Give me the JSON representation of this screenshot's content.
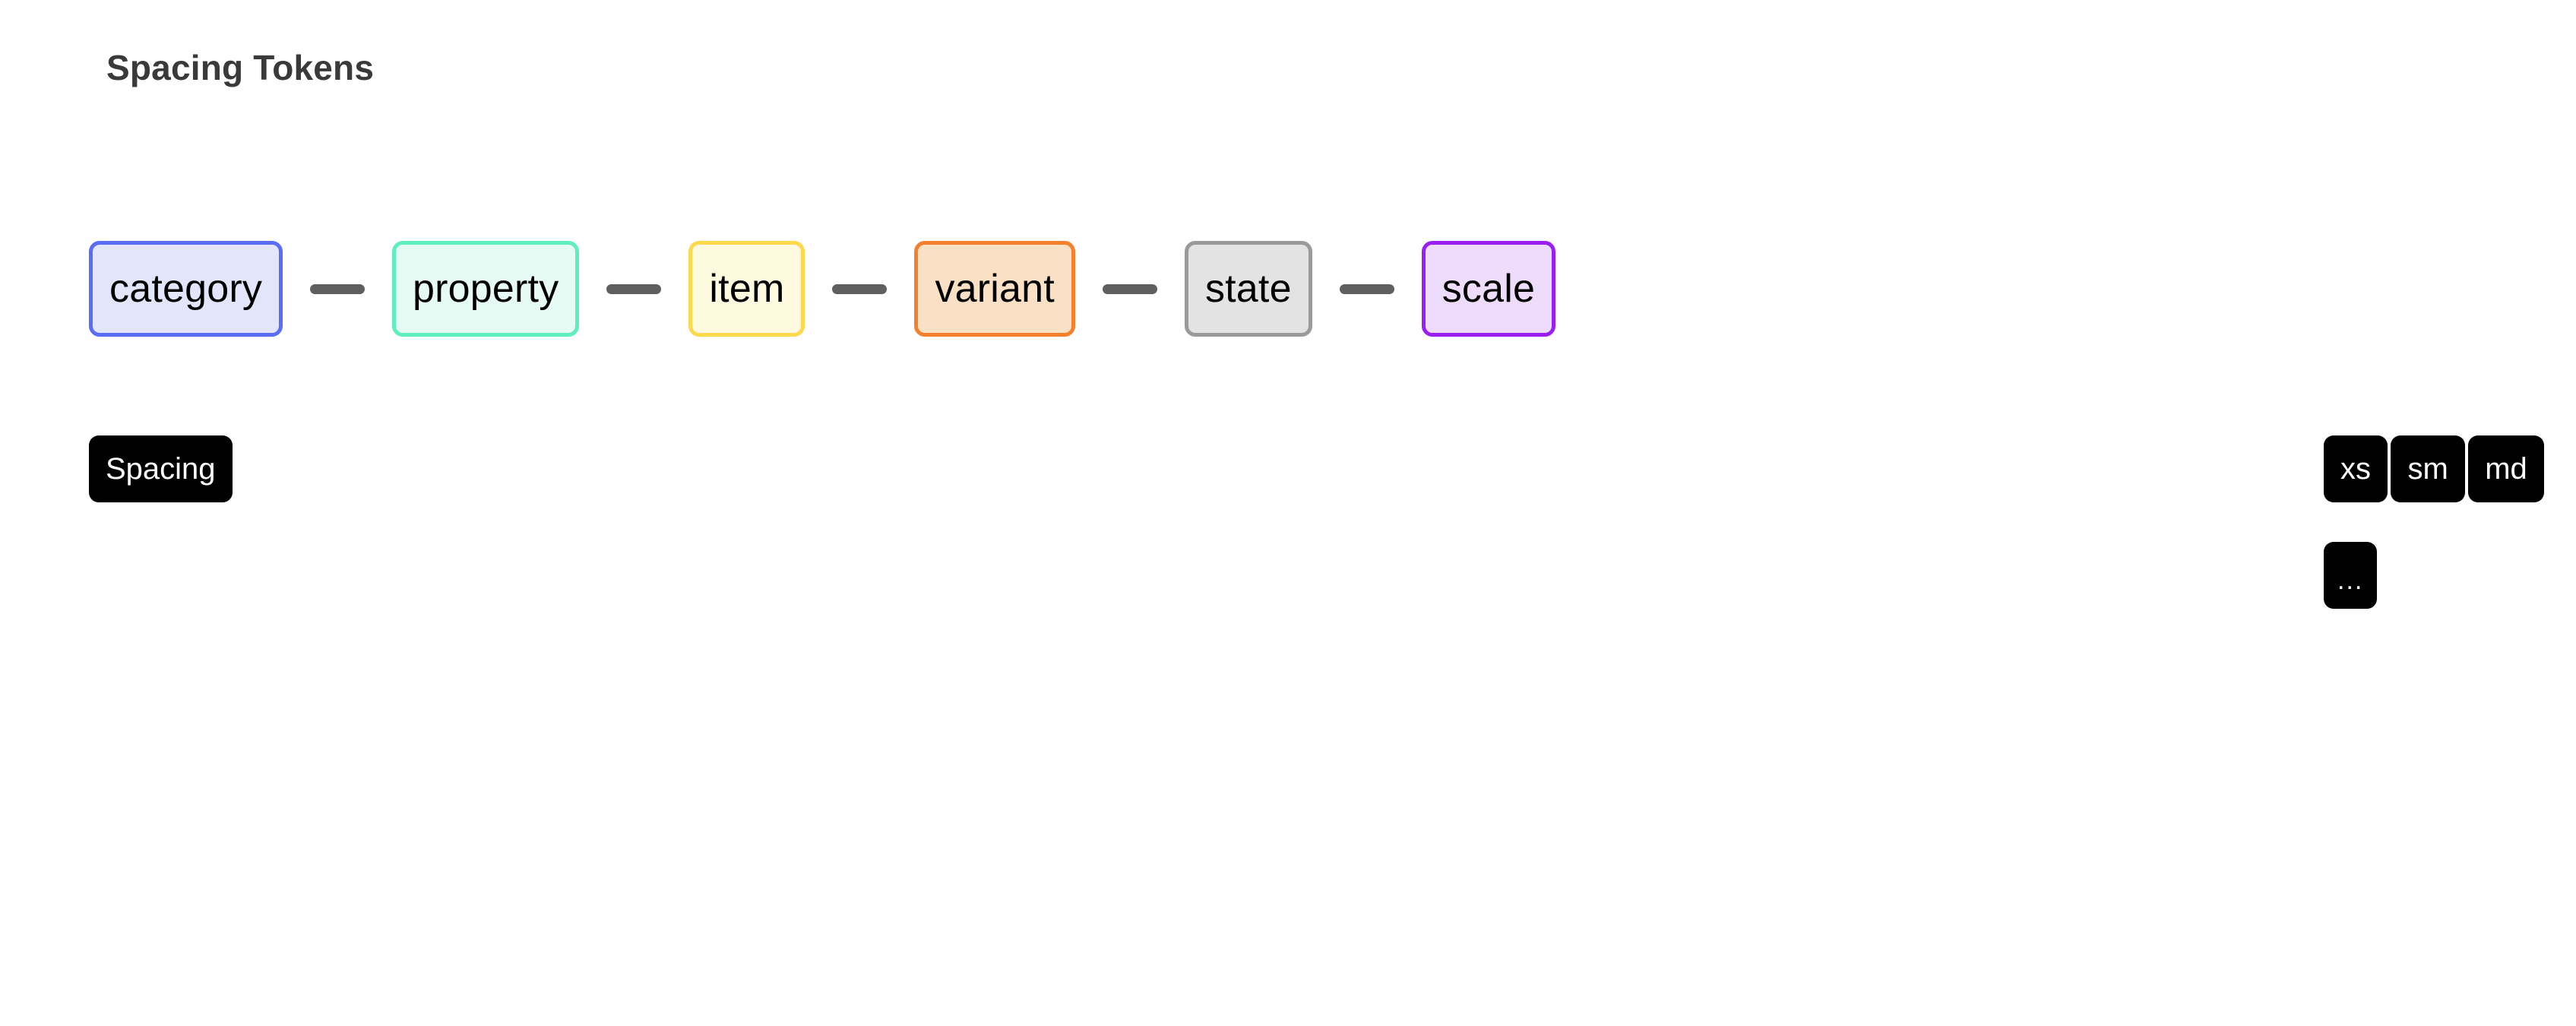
{
  "title": "Spacing Tokens",
  "token_path": {
    "connector_color": "#5f5f5f",
    "chips": [
      {
        "label": "category",
        "fill": "#e3e6fb",
        "border": "#5b6cf5"
      },
      {
        "label": "property",
        "fill": "#e6fbf3",
        "border": "#5eeec0"
      },
      {
        "label": "item",
        "fill": "#fdfae0",
        "border": "#ffd84d"
      },
      {
        "label": "variant",
        "fill": "#fae0c4",
        "border": "#f2802c"
      },
      {
        "label": "state",
        "fill": "#e3e3e3",
        "border": "#9a9a9a"
      },
      {
        "label": "scale",
        "fill": "#eedcfd",
        "border": "#9b1ef5"
      }
    ]
  },
  "category_value": {
    "label": "Spacing"
  },
  "scale_values": {
    "items": [
      {
        "label": "xs"
      },
      {
        "label": "sm"
      },
      {
        "label": "md"
      },
      {
        "label": "..."
      }
    ]
  }
}
